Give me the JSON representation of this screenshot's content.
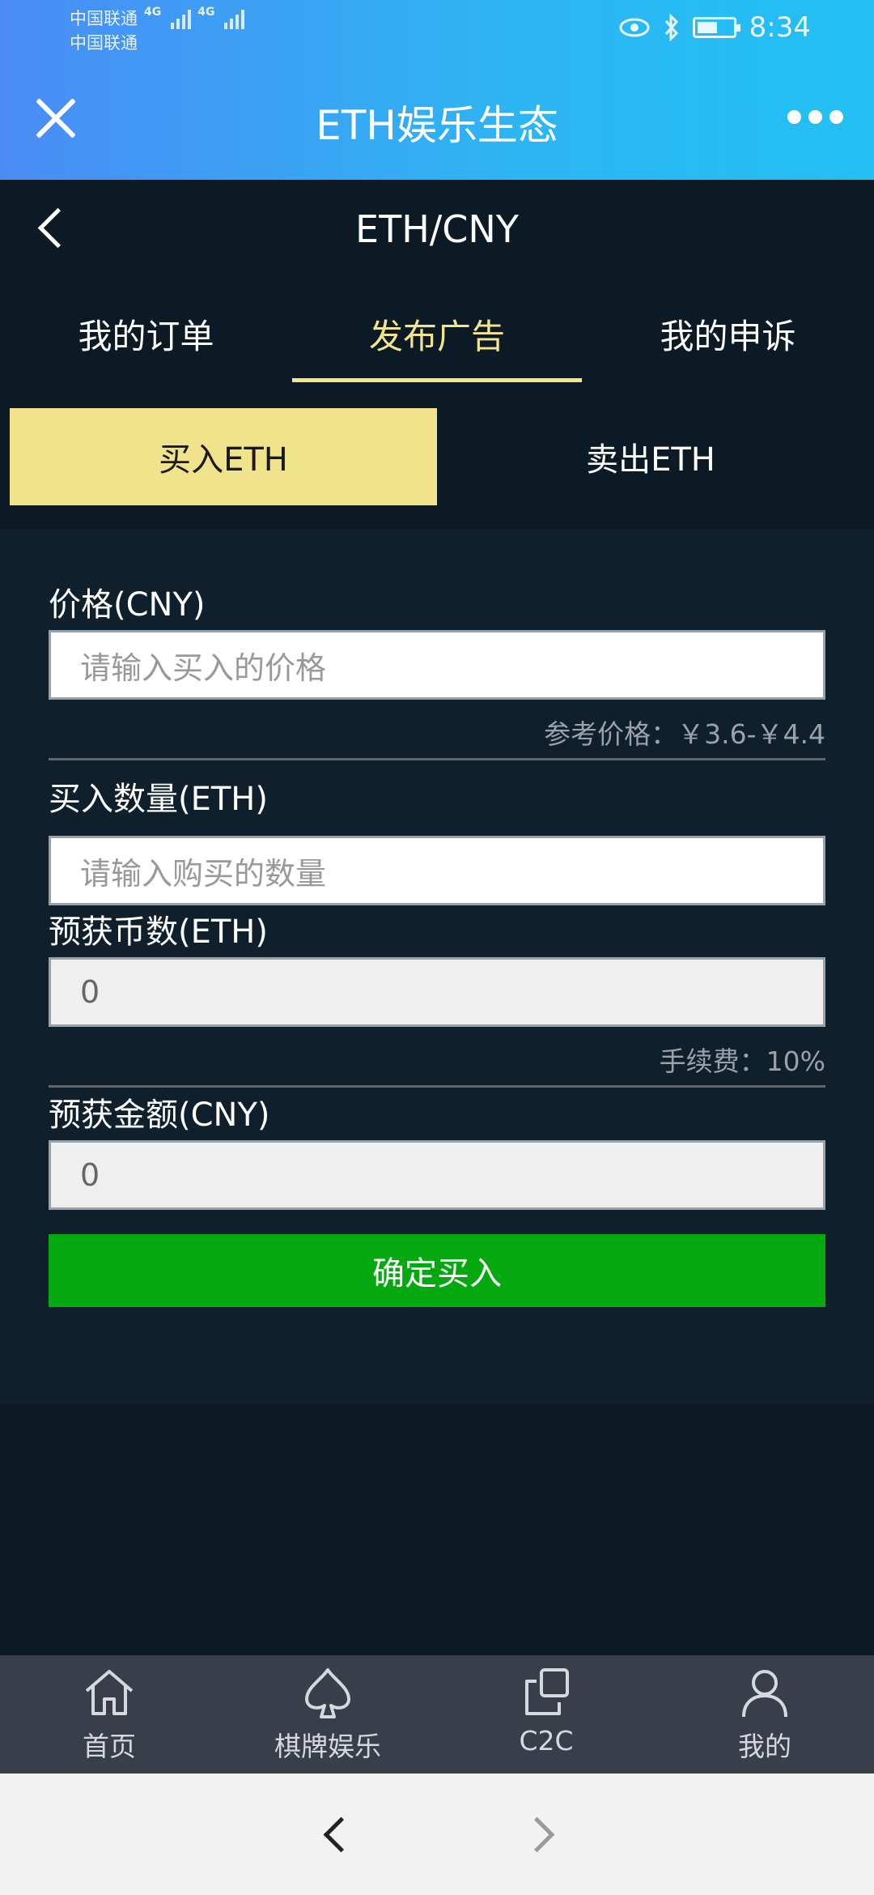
{
  "status": {
    "carrier1": "中国联通",
    "carrier2": "中国联通",
    "net1": "4G",
    "net2": "4G",
    "time": "8:34"
  },
  "app": {
    "title": "ETH娱乐生态"
  },
  "header": {
    "title": "ETH/CNY"
  },
  "tabs": [
    {
      "label": "我的订单"
    },
    {
      "label": "发布广告"
    },
    {
      "label": "我的申诉"
    }
  ],
  "switch": {
    "buy": "买入ETH",
    "sell": "卖出ETH"
  },
  "form": {
    "price_label": "价格(CNY)",
    "price_placeholder": "请输入买入的价格",
    "ref_price": "参考价格：￥3.6-￥4.4",
    "qty_label": "买入数量(ETH)",
    "qty_placeholder": "请输入购买的数量",
    "coins_label": "预获币数(ETH)",
    "coins_value": "0",
    "fee": "手续费：10%",
    "amount_label": "预获金额(CNY)",
    "amount_value": "0",
    "submit": "确定买入"
  },
  "nav": [
    {
      "label": "首页",
      "icon": "home-icon"
    },
    {
      "label": "棋牌娱乐",
      "icon": "spade-icon"
    },
    {
      "label": "C2C",
      "icon": "c2c-icon"
    },
    {
      "label": "我的",
      "icon": "user-icon"
    }
  ]
}
